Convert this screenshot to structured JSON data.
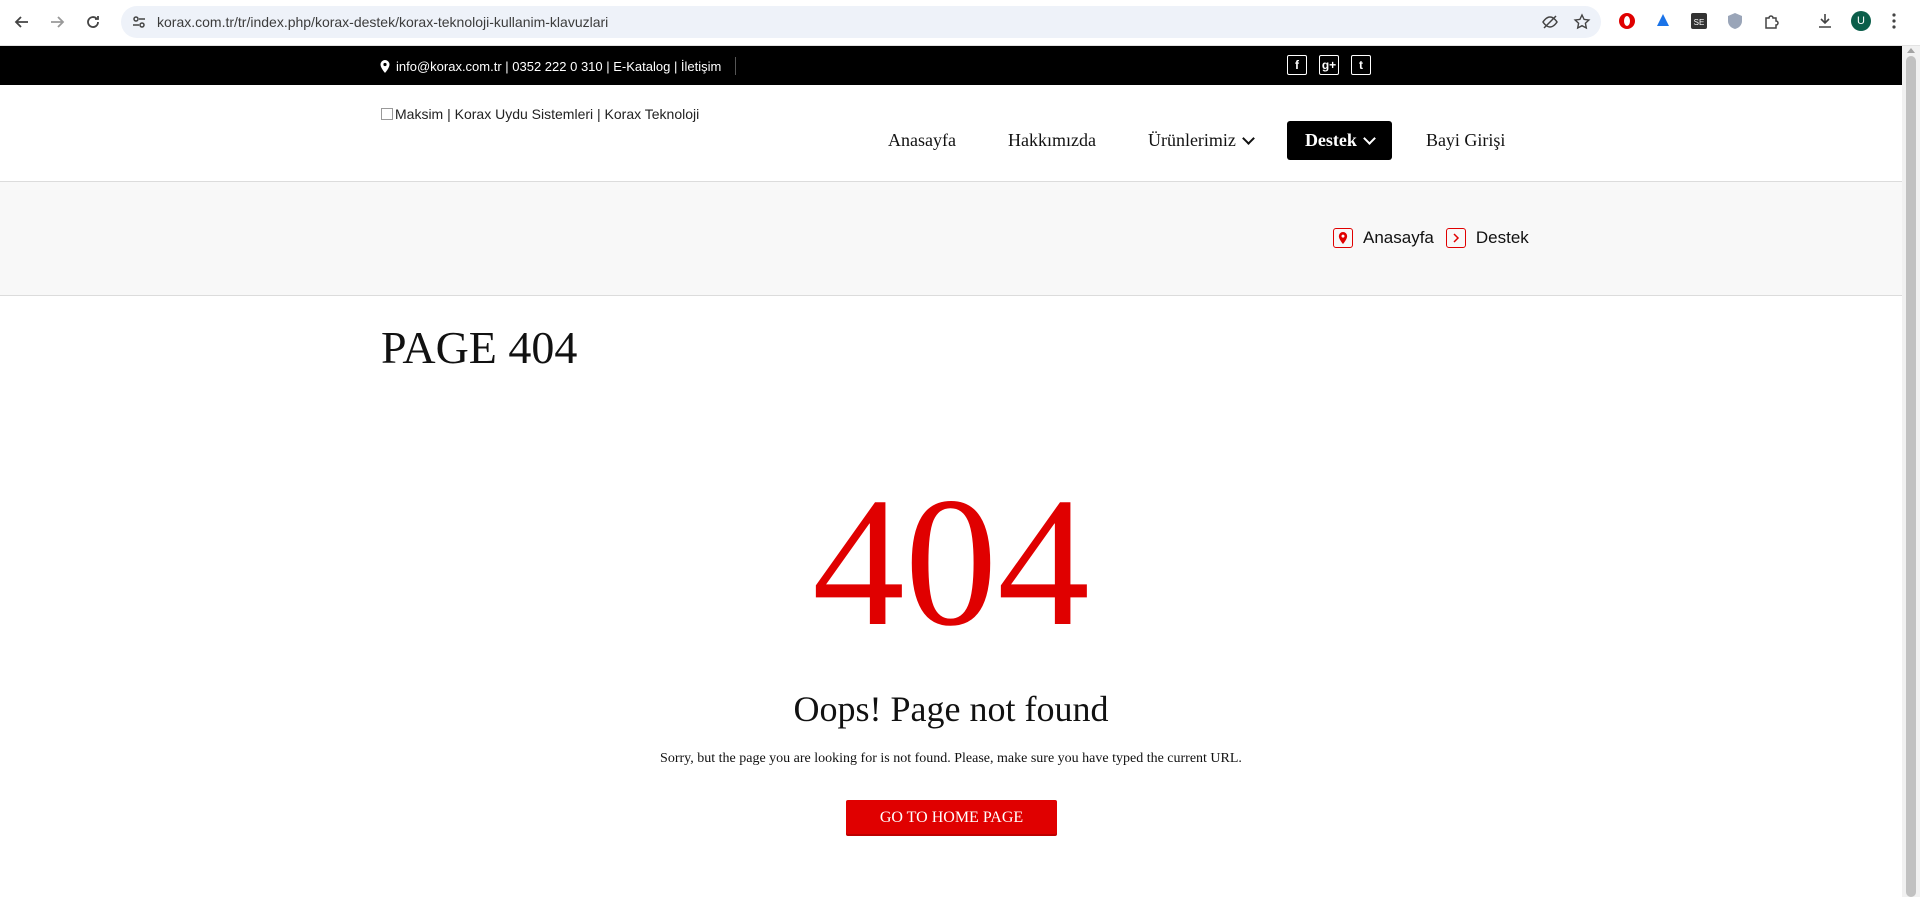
{
  "browser": {
    "url": "korax.com.tr/tr/index.php/korax-destek/korax-teknoloji-kullanim-klavuzlari",
    "profile_initial": "U"
  },
  "topbar": {
    "contact": "info@korax.com.tr | 0352 222 0 310 | E-Katalog | İletişim",
    "social": [
      "f",
      "g+",
      "t"
    ]
  },
  "header": {
    "logo_alt": "Maksim | Korax Uydu Sistemleri | Korax Teknoloji",
    "menu": [
      {
        "label": "Anasayfa"
      },
      {
        "label": "Hakkımızda"
      },
      {
        "label": "Ürünlerimiz"
      },
      {
        "label": "Destek"
      },
      {
        "label": "Bayi Girişi"
      }
    ]
  },
  "breadcrumb": {
    "home": "Anasayfa",
    "current": "Destek"
  },
  "main": {
    "title": "PAGE 404",
    "code": "404",
    "heading": "Oops! Page not found",
    "message": "Sorry, but the page you are looking for is not found. Please, make sure you have typed the current URL.",
    "button": "GO TO HOME PAGE"
  },
  "colors": {
    "accent": "#e00000",
    "topbar": "#000000"
  }
}
